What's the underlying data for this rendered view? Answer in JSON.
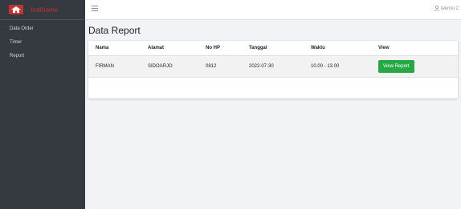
{
  "brand": {
    "name": "Indihome"
  },
  "sidebar": {
    "items": [
      {
        "label": "Data Order"
      },
      {
        "label": "Timer"
      },
      {
        "label": "Report"
      }
    ]
  },
  "topbar": {
    "user_label": "teknisi 2"
  },
  "page": {
    "title": "Data Report"
  },
  "table": {
    "headers": [
      "Nama",
      "Alamat",
      "No HP",
      "Tanggal",
      "Waktu",
      "View"
    ],
    "rows": [
      {
        "nama": "FIRMAN",
        "alamat": "SIDOARJO",
        "nohp": "0812",
        "tanggal": "2022-07-30",
        "waktu": "10.00 - 13.00",
        "view_label": "View Report"
      }
    ]
  },
  "colors": {
    "sidebar": "#343a40",
    "brand_text": "#c53030",
    "button": "#28a745",
    "background": "#f2f3f6"
  },
  "icons": {
    "logo": "house-logo-icon",
    "menu": "hamburger-icon",
    "user": "user-icon"
  }
}
